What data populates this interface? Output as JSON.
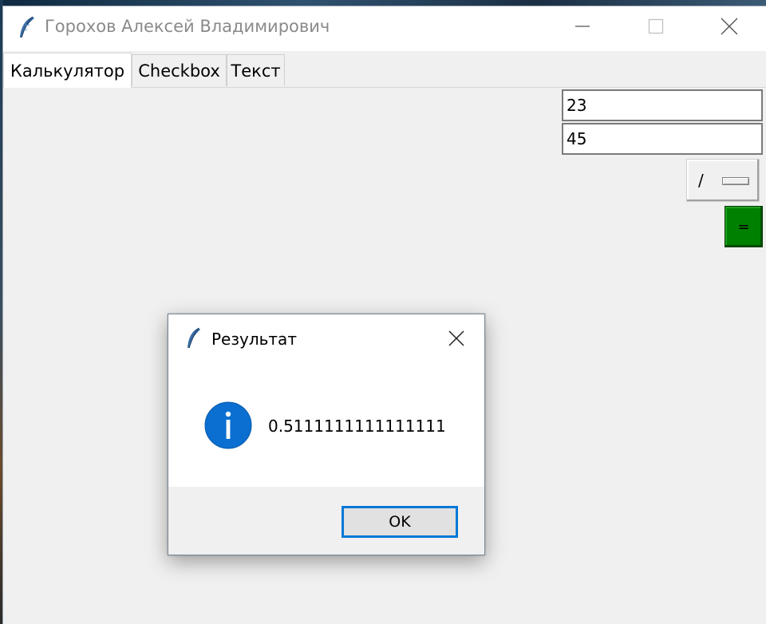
{
  "window": {
    "title": "Горохов Алексей Владимирович"
  },
  "tabs": [
    {
      "label": "Калькулятор",
      "selected": true
    },
    {
      "label": "Checkbox",
      "selected": false
    },
    {
      "label": "Текст",
      "selected": false
    }
  ],
  "calculator": {
    "input_a": "23",
    "input_b": "45",
    "operator": "/",
    "equals_label": "=",
    "equals_color": "#008000"
  },
  "dialog": {
    "title": "Результат",
    "icon": "info-icon",
    "message": "0.5111111111111111",
    "ok_label": "OK",
    "accent": "#0078d7"
  }
}
